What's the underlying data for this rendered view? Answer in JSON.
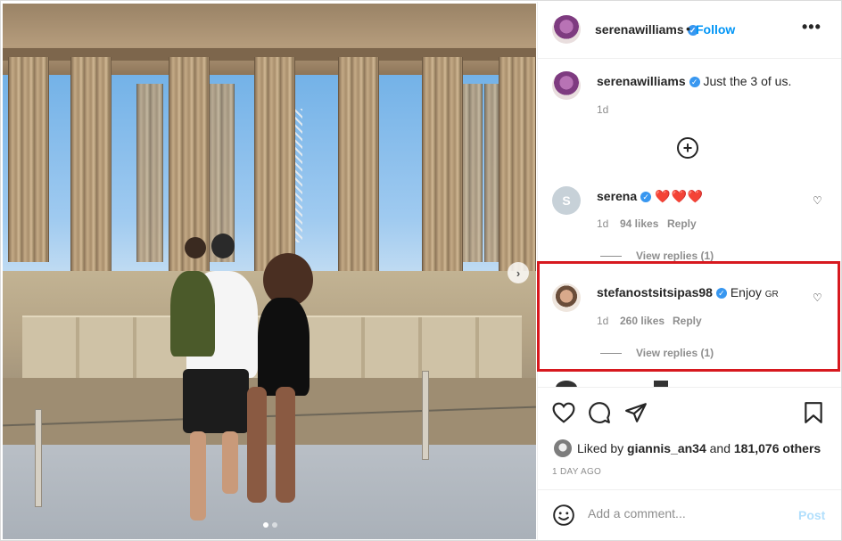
{
  "post": {
    "slide_count": 2,
    "active_slide": 1
  },
  "header": {
    "username": "serenawilliams",
    "separator": "•",
    "follow_label": "Follow",
    "more_label": "•••"
  },
  "caption": {
    "username": "serenawilliams",
    "text": "Just the 3 of us.",
    "time": "1d"
  },
  "load_more_label": "+",
  "comments": [
    {
      "avatar_letter": "S",
      "username": "serena",
      "text": "❤️❤️❤️",
      "time": "1d",
      "likes": "94 likes",
      "reply_label": "Reply",
      "view_replies": "View replies (1)"
    },
    {
      "username": "stefanostsitsipas98",
      "text": "Enjoy",
      "flag": "GR",
      "time": "1d",
      "likes": "260 likes",
      "reply_label": "Reply",
      "view_replies": "View replies (1)"
    }
  ],
  "likes_summary": {
    "prefix": "Liked by",
    "user": "giannis_an34",
    "and": "and",
    "others": "181,076 others"
  },
  "timestamp": "1 DAY AGO",
  "composer": {
    "placeholder": "Add a comment...",
    "post_label": "Post"
  },
  "icons": {
    "like": "heart-icon",
    "comment": "comment-icon",
    "share": "paper-plane-icon",
    "save": "bookmark-icon",
    "emoji": "smiley-icon",
    "next": "chevron-right-icon"
  },
  "colors": {
    "accent": "#0095f6",
    "highlight": "#d7191f",
    "heart": "#d4162b"
  }
}
